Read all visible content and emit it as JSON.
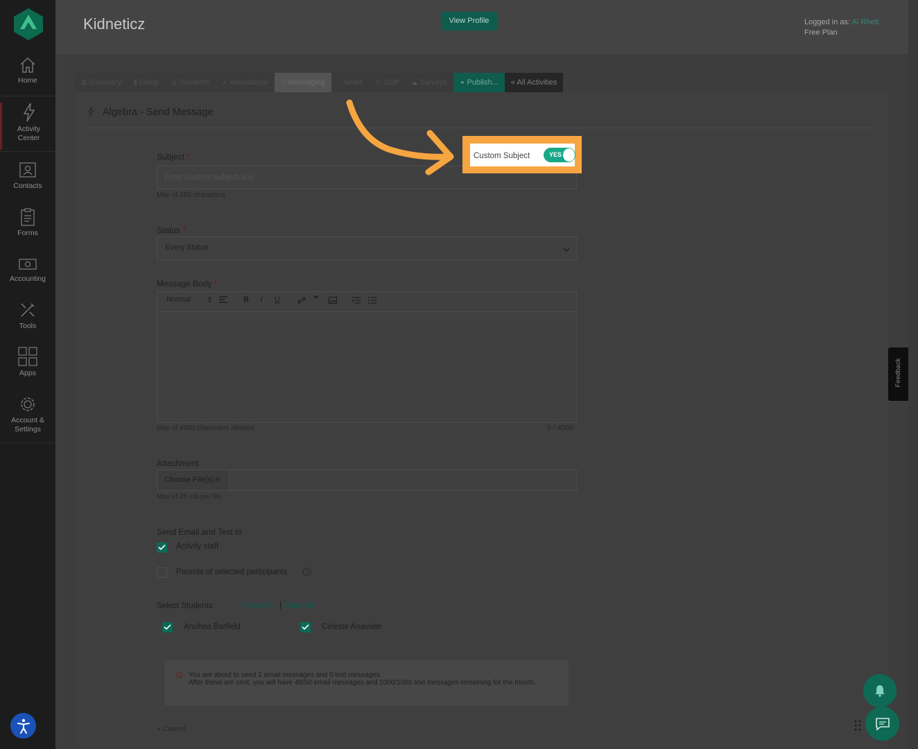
{
  "sidebar": {
    "items": [
      {
        "label": "Home"
      },
      {
        "label": "Activity Center"
      },
      {
        "label": "Contacts"
      },
      {
        "label": "Forms"
      },
      {
        "label": "Accounting"
      },
      {
        "label": "Tools"
      },
      {
        "label": "Apps"
      },
      {
        "label": "Account & Settings"
      }
    ]
  },
  "header": {
    "title": "Kidneticz",
    "view_profile": "View Profile",
    "logged_in_prefix": "Logged in as:",
    "user": "Al Rhett",
    "plan": "Free Plan"
  },
  "tabs": [
    {
      "label": "Summary"
    },
    {
      "label": "Setup"
    },
    {
      "label": "Students"
    },
    {
      "label": "Attendance"
    },
    {
      "label": "Messaging"
    },
    {
      "label": "Notes"
    },
    {
      "label": "Staff"
    },
    {
      "label": "Surveys"
    },
    {
      "label": "Publish..."
    },
    {
      "label": "« All Activities"
    }
  ],
  "page": {
    "title": "Algebra - Send Message"
  },
  "custom_subject": {
    "label": "Custom Subject",
    "toggle": "YES",
    "enabled": true
  },
  "form": {
    "subject": {
      "label": "Subject",
      "required": "*",
      "placeholder": "Enter custom subject line",
      "hint": "Max of 150 characters"
    },
    "status": {
      "label": "Status",
      "required": "*",
      "value": "Every Status"
    },
    "body": {
      "label": "Message Body",
      "required": "*",
      "format": "Normal",
      "hint": "Max of 4000 characters allowed",
      "counter": "0 / 4000"
    },
    "attachment": {
      "label": "Attachment",
      "button": "Choose File(s)",
      "hint": "Max of 25 mb per file"
    },
    "send_to": {
      "label": "Send Email and Text to",
      "options": [
        {
          "label": "Activity staff",
          "checked": true
        },
        {
          "label": "Parents of selected participants",
          "checked": false
        }
      ]
    },
    "students": {
      "label": "Select Students",
      "select_all": "Select All",
      "separator": "|",
      "clear_all": "Clear All",
      "list": [
        {
          "name": "Anuhea Barfield",
          "checked": true
        },
        {
          "name": "Celeste Anaviate",
          "checked": true
        }
      ]
    },
    "notice": {
      "line1": "You are about to send 2 email messages and 0 text messages.",
      "line2": "After these are sent, you will have 48/50 email messages and 1000/1000 text messages remaining for the month."
    },
    "cancel": "« Cancel"
  },
  "feedback": "Feedback",
  "colors": {
    "accent": "#17a889",
    "highlight": "#f7a541",
    "sidebar": "#1c1c1c"
  }
}
